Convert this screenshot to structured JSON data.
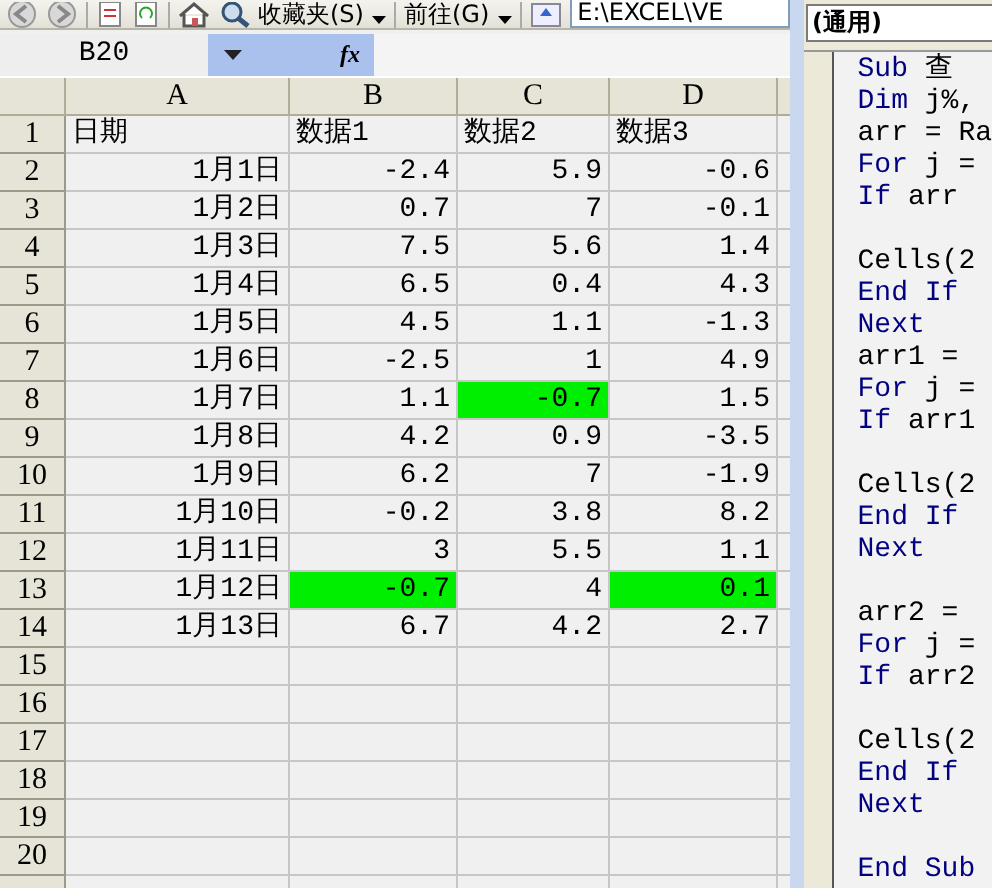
{
  "toolbar": {
    "favorites_menu": "收藏夹(S)",
    "go_menu": "前往(G)",
    "address": "E:\\EXCEL\\VE"
  },
  "formula_bar": {
    "name_box": "B20",
    "fx": "fx"
  },
  "sheet": {
    "columns": [
      "A",
      "B",
      "C",
      "D"
    ],
    "rows": [
      {
        "number": "1",
        "kind": "header",
        "cells": [
          {
            "text": "日期",
            "highlighted": false
          },
          {
            "text": "数据1",
            "highlighted": false
          },
          {
            "text": "数据2",
            "highlighted": false
          },
          {
            "text": "数据3",
            "highlighted": false
          }
        ]
      },
      {
        "number": "2",
        "kind": "data",
        "cells": [
          {
            "text": "1月1日",
            "highlighted": false
          },
          {
            "text": "-2.4",
            "highlighted": false
          },
          {
            "text": "5.9",
            "highlighted": false
          },
          {
            "text": "-0.6",
            "highlighted": false
          }
        ]
      },
      {
        "number": "3",
        "kind": "data",
        "cells": [
          {
            "text": "1月2日",
            "highlighted": false
          },
          {
            "text": "0.7",
            "highlighted": false
          },
          {
            "text": "7",
            "highlighted": false
          },
          {
            "text": "-0.1",
            "highlighted": false
          }
        ]
      },
      {
        "number": "4",
        "kind": "data",
        "cells": [
          {
            "text": "1月3日",
            "highlighted": false
          },
          {
            "text": "7.5",
            "highlighted": false
          },
          {
            "text": "5.6",
            "highlighted": false
          },
          {
            "text": "1.4",
            "highlighted": false
          }
        ]
      },
      {
        "number": "5",
        "kind": "data",
        "cells": [
          {
            "text": "1月4日",
            "highlighted": false
          },
          {
            "text": "6.5",
            "highlighted": false
          },
          {
            "text": "0.4",
            "highlighted": false
          },
          {
            "text": "4.3",
            "highlighted": false
          }
        ]
      },
      {
        "number": "6",
        "kind": "data",
        "cells": [
          {
            "text": "1月5日",
            "highlighted": false
          },
          {
            "text": "4.5",
            "highlighted": false
          },
          {
            "text": "1.1",
            "highlighted": false
          },
          {
            "text": "-1.3",
            "highlighted": false
          }
        ]
      },
      {
        "number": "7",
        "kind": "data",
        "cells": [
          {
            "text": "1月6日",
            "highlighted": false
          },
          {
            "text": "-2.5",
            "highlighted": false
          },
          {
            "text": "1",
            "highlighted": false
          },
          {
            "text": "4.9",
            "highlighted": false
          }
        ]
      },
      {
        "number": "8",
        "kind": "data",
        "cells": [
          {
            "text": "1月7日",
            "highlighted": false
          },
          {
            "text": "1.1",
            "highlighted": false
          },
          {
            "text": "-0.7",
            "highlighted": true
          },
          {
            "text": "1.5",
            "highlighted": false
          }
        ]
      },
      {
        "number": "9",
        "kind": "data",
        "cells": [
          {
            "text": "1月8日",
            "highlighted": false
          },
          {
            "text": "4.2",
            "highlighted": false
          },
          {
            "text": "0.9",
            "highlighted": false
          },
          {
            "text": "-3.5",
            "highlighted": false
          }
        ]
      },
      {
        "number": "10",
        "kind": "data",
        "cells": [
          {
            "text": "1月9日",
            "highlighted": false
          },
          {
            "text": "6.2",
            "highlighted": false
          },
          {
            "text": "7",
            "highlighted": false
          },
          {
            "text": "-1.9",
            "highlighted": false
          }
        ]
      },
      {
        "number": "11",
        "kind": "data",
        "cells": [
          {
            "text": "1月10日",
            "highlighted": false
          },
          {
            "text": "-0.2",
            "highlighted": false
          },
          {
            "text": "3.8",
            "highlighted": false
          },
          {
            "text": "8.2",
            "highlighted": false
          }
        ]
      },
      {
        "number": "12",
        "kind": "data",
        "cells": [
          {
            "text": "1月11日",
            "highlighted": false
          },
          {
            "text": "3",
            "highlighted": false
          },
          {
            "text": "5.5",
            "highlighted": false
          },
          {
            "text": "1.1",
            "highlighted": false
          }
        ]
      },
      {
        "number": "13",
        "kind": "data",
        "cells": [
          {
            "text": "1月12日",
            "highlighted": false
          },
          {
            "text": "-0.7",
            "highlighted": true
          },
          {
            "text": "4",
            "highlighted": false
          },
          {
            "text": "0.1",
            "highlighted": true
          }
        ]
      },
      {
        "number": "14",
        "kind": "data",
        "cells": [
          {
            "text": "1月13日",
            "highlighted": false
          },
          {
            "text": "6.7",
            "highlighted": false
          },
          {
            "text": "4.2",
            "highlighted": false
          },
          {
            "text": "2.7",
            "highlighted": false
          }
        ]
      },
      {
        "number": "15",
        "kind": "empty"
      },
      {
        "number": "16",
        "kind": "empty"
      },
      {
        "number": "17",
        "kind": "empty"
      },
      {
        "number": "18",
        "kind": "empty"
      },
      {
        "number": "19",
        "kind": "empty"
      },
      {
        "number": "20",
        "kind": "empty"
      }
    ]
  },
  "code_pane": {
    "object_dropdown": "(通用)",
    "lines": [
      {
        "kind": "code",
        "tokens": [
          {
            "kind": "keyword",
            "text": "Sub"
          },
          {
            "kind": "plain",
            "text": " 查"
          }
        ]
      },
      {
        "kind": "code",
        "tokens": [
          {
            "kind": "keyword",
            "text": "Dim"
          },
          {
            "kind": "plain",
            "text": " j%,"
          }
        ]
      },
      {
        "kind": "code",
        "tokens": [
          {
            "kind": "plain",
            "text": "arr = Ra"
          }
        ]
      },
      {
        "kind": "code",
        "tokens": [
          {
            "kind": "keyword",
            "text": "For"
          },
          {
            "kind": "plain",
            "text": " j ="
          }
        ]
      },
      {
        "kind": "code",
        "tokens": [
          {
            "kind": "keyword",
            "text": "If"
          },
          {
            "kind": "plain",
            "text": " arr"
          }
        ]
      },
      {
        "kind": "blank"
      },
      {
        "kind": "code",
        "tokens": [
          {
            "kind": "plain",
            "text": "Cells(2"
          }
        ]
      },
      {
        "kind": "code",
        "tokens": [
          {
            "kind": "keyword",
            "text": "End If"
          }
        ]
      },
      {
        "kind": "code",
        "tokens": [
          {
            "kind": "keyword",
            "text": "Next"
          }
        ]
      },
      {
        "kind": "code",
        "tokens": [
          {
            "kind": "plain",
            "text": "arr1 ="
          }
        ]
      },
      {
        "kind": "code",
        "tokens": [
          {
            "kind": "keyword",
            "text": "For"
          },
          {
            "kind": "plain",
            "text": " j ="
          }
        ]
      },
      {
        "kind": "code",
        "tokens": [
          {
            "kind": "keyword",
            "text": "If"
          },
          {
            "kind": "plain",
            "text": " arr1"
          }
        ]
      },
      {
        "kind": "blank"
      },
      {
        "kind": "code",
        "tokens": [
          {
            "kind": "plain",
            "text": "Cells(2"
          }
        ]
      },
      {
        "kind": "code",
        "tokens": [
          {
            "kind": "keyword",
            "text": "End If"
          }
        ]
      },
      {
        "kind": "code",
        "tokens": [
          {
            "kind": "keyword",
            "text": "Next"
          }
        ]
      },
      {
        "kind": "blank"
      },
      {
        "kind": "code",
        "tokens": [
          {
            "kind": "plain",
            "text": "arr2 ="
          }
        ]
      },
      {
        "kind": "code",
        "tokens": [
          {
            "kind": "keyword",
            "text": "For"
          },
          {
            "kind": "plain",
            "text": " j ="
          }
        ]
      },
      {
        "kind": "code",
        "tokens": [
          {
            "kind": "keyword",
            "text": "If"
          },
          {
            "kind": "plain",
            "text": " arr2"
          }
        ]
      },
      {
        "kind": "blank"
      },
      {
        "kind": "code",
        "tokens": [
          {
            "kind": "plain",
            "text": "Cells(2"
          }
        ]
      },
      {
        "kind": "code",
        "tokens": [
          {
            "kind": "keyword",
            "text": "End If"
          }
        ]
      },
      {
        "kind": "code",
        "tokens": [
          {
            "kind": "keyword",
            "text": "Next"
          }
        ]
      },
      {
        "kind": "blank"
      },
      {
        "kind": "code",
        "tokens": [
          {
            "kind": "keyword",
            "text": "End Sub"
          }
        ]
      }
    ]
  }
}
